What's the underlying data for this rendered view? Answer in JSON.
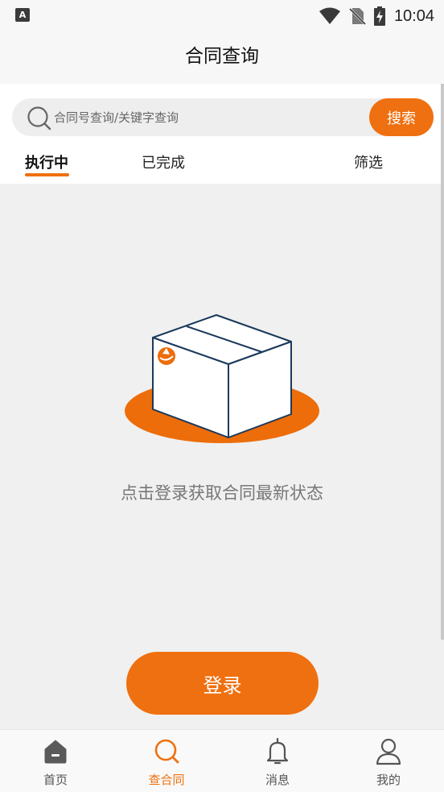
{
  "status_bar": {
    "left_icon_letter": "A",
    "time": "10:04"
  },
  "header": {
    "title": "合同查询"
  },
  "search": {
    "placeholder": "合同号查询/关键字查询",
    "button_label": "搜索"
  },
  "tabs": [
    {
      "label": "执行中",
      "active": true
    },
    {
      "label": "已完成",
      "active": false
    }
  ],
  "filter_label": "筛选",
  "empty_state": {
    "message": "点击登录获取合同最新状态"
  },
  "login_button_label": "登录",
  "bottom_nav": [
    {
      "label": "首页",
      "icon": "home-icon",
      "active": false
    },
    {
      "label": "查合同",
      "icon": "search-icon",
      "active": true
    },
    {
      "label": "消息",
      "icon": "bell-icon",
      "active": false
    },
    {
      "label": "我的",
      "icon": "user-icon",
      "active": false
    }
  ],
  "colors": {
    "accent": "#ef7010",
    "background": "#f0f0f0",
    "header_bg": "#f7f7f7"
  }
}
